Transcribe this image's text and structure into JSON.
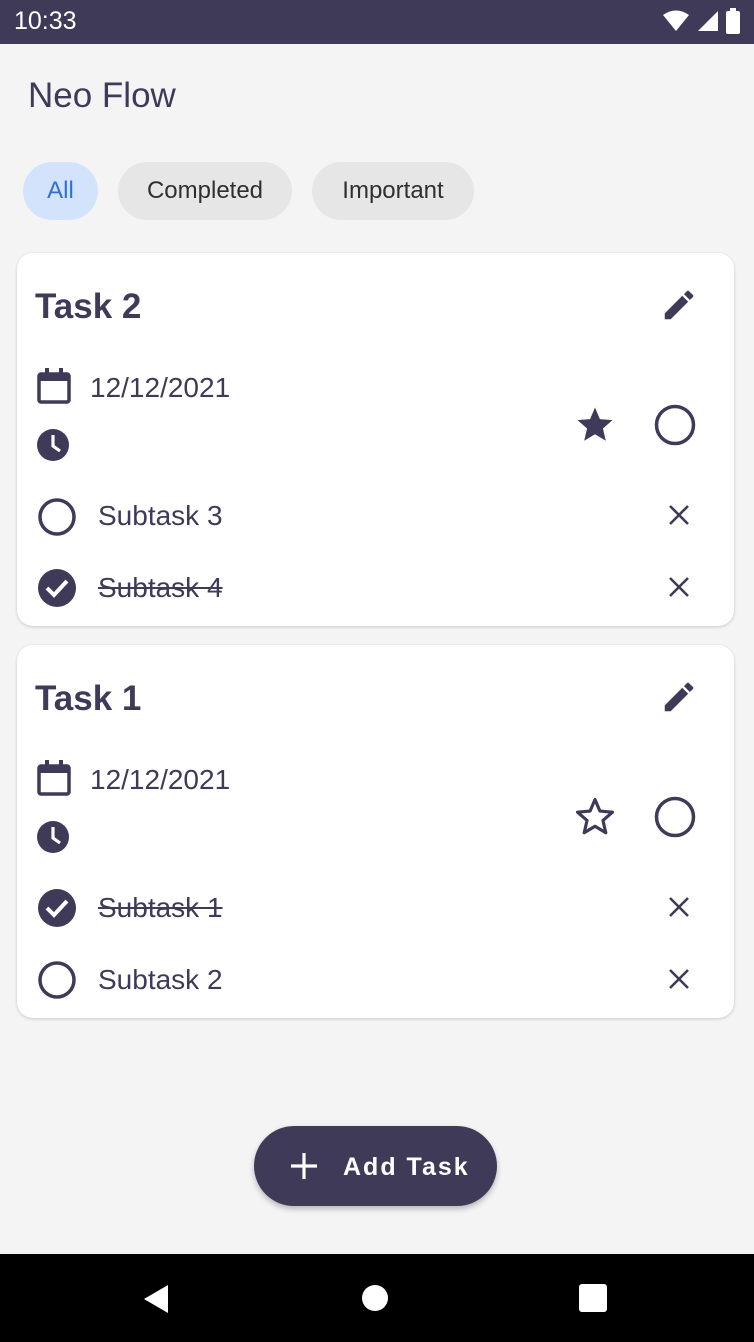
{
  "status_bar": {
    "time": "10:33"
  },
  "app": {
    "title": "Neo Flow"
  },
  "filters": [
    {
      "label": "All",
      "selected": true
    },
    {
      "label": "Completed",
      "selected": false
    },
    {
      "label": "Important",
      "selected": false
    }
  ],
  "tasks": [
    {
      "title": "Task 2",
      "date": "12/12/2021",
      "important": true,
      "completed": false,
      "subtasks": [
        {
          "label": "Subtask 3",
          "done": false
        },
        {
          "label": "Subtask 4",
          "done": true
        }
      ]
    },
    {
      "title": "Task 1",
      "date": "12/12/2021",
      "important": false,
      "completed": false,
      "subtasks": [
        {
          "label": "Subtask 1",
          "done": true
        },
        {
          "label": "Subtask 2",
          "done": false
        }
      ]
    }
  ],
  "fab": {
    "label": "Add Task"
  },
  "colors": {
    "primary": "#403a59",
    "chip_selected_bg": "#d4e3fc",
    "chip_selected_text": "#2e6fd8",
    "background": "#f4f4f4"
  }
}
